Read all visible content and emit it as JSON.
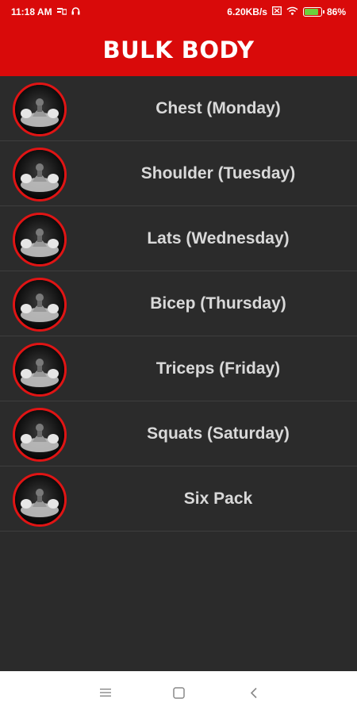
{
  "status_bar": {
    "time": "11:18 AM",
    "network_speed": "6.20KB/s",
    "battery_percent": "86%",
    "battery_level": 0.86
  },
  "app_bar": {
    "title": "BULK BODY"
  },
  "workouts": [
    {
      "label": "Chest (Monday)",
      "icon": "bodybuilder-avatar-icon"
    },
    {
      "label": "Shoulder (Tuesday)",
      "icon": "bodybuilder-avatar-icon"
    },
    {
      "label": "Lats (Wednesday)",
      "icon": "bodybuilder-avatar-icon"
    },
    {
      "label": "Bicep (Thursday)",
      "icon": "bodybuilder-avatar-icon"
    },
    {
      "label": "Triceps (Friday)",
      "icon": "bodybuilder-avatar-icon"
    },
    {
      "label": "Squats (Saturday)",
      "icon": "bodybuilder-avatar-icon"
    },
    {
      "label": "Six Pack",
      "icon": "bodybuilder-avatar-icon"
    }
  ],
  "nav_bar": {
    "menu_icon": "menu-icon",
    "home_icon": "home-icon",
    "back_icon": "back-icon"
  },
  "colors": {
    "accent": "#d90a0a",
    "background": "#2b2b2b",
    "label": "#d9d9d9",
    "avatar_border": "#e01414"
  }
}
